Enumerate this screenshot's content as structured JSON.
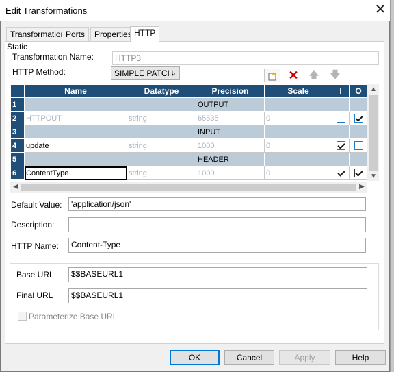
{
  "window": {
    "title": "Edit Transformations",
    "close_symbol": "✕"
  },
  "tabs": [
    {
      "label": "Transformation",
      "active": false
    },
    {
      "label": "Ports",
      "active": false
    },
    {
      "label": "Properties",
      "active": false
    },
    {
      "label": "HTTP",
      "active": true
    }
  ],
  "form": {
    "static_label": "Static",
    "transformation_name_label": "Transformation Name:",
    "transformation_name_value": "HTTP3",
    "http_method_label": "HTTP Method:",
    "http_method_value": "SIMPLE PATCH"
  },
  "toolbar": {
    "icons": [
      "new-port-icon",
      "delete-icon",
      "move-up-icon",
      "move-down-icon"
    ]
  },
  "grid": {
    "columns": {
      "name": "Name",
      "datatype": "Datatype",
      "precision": "Precision",
      "scale": "Scale",
      "input": "I",
      "output": "O"
    },
    "rows": [
      {
        "num": "1",
        "name": "",
        "datatype": "",
        "precision": "OUTPUT",
        "scale": ""
      },
      {
        "num": "2",
        "name": "HTTPOUT",
        "datatype": "string",
        "precision": "65535",
        "scale": "0",
        "input": false,
        "output": true
      },
      {
        "num": "3",
        "name": "",
        "datatype": "",
        "precision": "INPUT",
        "scale": ""
      },
      {
        "num": "4",
        "name": "update",
        "datatype": "string",
        "precision": "1000",
        "scale": "0",
        "input": true,
        "output": false
      },
      {
        "num": "5",
        "name": "",
        "datatype": "",
        "precision": "HEADER",
        "scale": ""
      },
      {
        "num": "6",
        "name": "ContentType",
        "datatype": "string",
        "precision": "1000",
        "scale": "0",
        "input": true,
        "output": true
      }
    ]
  },
  "details": {
    "default_value_label": "Default Value:",
    "default_value": "'application/json'",
    "description_label": "Description:",
    "description_value": "",
    "http_name_label": "HTTP Name:",
    "http_name_value": "Content-Type"
  },
  "urls": {
    "base_url_label": "Base URL",
    "base_url_value": "$$BASEURL1",
    "final_url_label": "Final URL",
    "final_url_value": "$$BASEURL1",
    "parameterize_label": "Parameterize Base URL",
    "parameterize_checked": false
  },
  "buttons": {
    "ok": "OK",
    "cancel": "Cancel",
    "apply": "Apply",
    "help": "Help"
  }
}
